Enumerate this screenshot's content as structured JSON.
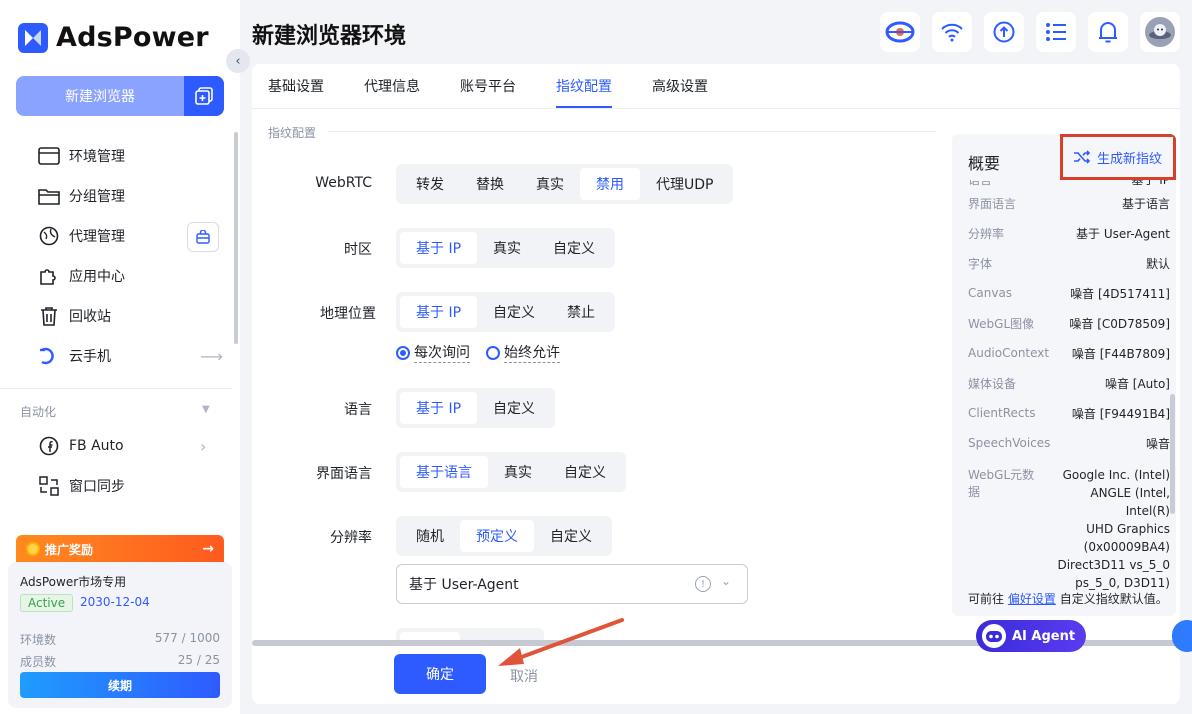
{
  "app": {
    "brand": "AdsPower",
    "page_title": "新建浏览器环境"
  },
  "sidebar": {
    "new_browser_label": "新建浏览器",
    "nav": [
      {
        "label": "环境管理",
        "icon": "browser-window-icon"
      },
      {
        "label": "分组管理",
        "icon": "folder-icon"
      },
      {
        "label": "代理管理",
        "icon": "globe-pin-icon"
      },
      {
        "label": "应用中心",
        "icon": "puzzle-icon"
      },
      {
        "label": "回收站",
        "icon": "trash-icon"
      },
      {
        "label": "云手机",
        "icon": "cloud-phone-icon"
      }
    ],
    "section_automation": "自动化",
    "nav2": [
      {
        "label": "FB Auto",
        "icon": "facebook-icon"
      },
      {
        "label": "窗口同步",
        "icon": "window-sync-icon"
      }
    ],
    "promo_label": "推广奖励",
    "plan": {
      "name": "AdsPower市场专用",
      "status": "Active",
      "expiry": "2030-12-04",
      "env_label": "环境数",
      "env_value": "577 / 1000",
      "member_label": "成员数",
      "member_value": "25 / 25",
      "renew_label": "续期"
    }
  },
  "tabs": [
    "基础设置",
    "代理信息",
    "账号平台",
    "指纹配置",
    "高级设置"
  ],
  "active_tab": "指纹配置",
  "form": {
    "section_title": "指纹配置",
    "webrtc": {
      "label": "WebRTC",
      "options": [
        "转发",
        "替换",
        "真实",
        "禁用",
        "代理UDP"
      ],
      "selected": "禁用"
    },
    "timezone": {
      "label": "时区",
      "options": [
        "基于 IP",
        "真实",
        "自定义"
      ],
      "selected": "基于 IP"
    },
    "geo": {
      "label": "地理位置",
      "options": [
        "基于 IP",
        "自定义",
        "禁止"
      ],
      "selected": "基于 IP",
      "radio_ask": "每次询问",
      "radio_allow": "始终允许",
      "radio_selected": "每次询问"
    },
    "language": {
      "label": "语言",
      "options": [
        "基于 IP",
        "自定义"
      ],
      "selected": "基于 IP"
    },
    "ui_language": {
      "label": "界面语言",
      "options": [
        "基于语言",
        "真实",
        "自定义"
      ],
      "selected": "基于语言"
    },
    "resolution": {
      "label": "分辨率",
      "options": [
        "随机",
        "预定义",
        "自定义"
      ],
      "selected": "预定义",
      "select_value": "基于 User-Agent"
    },
    "confirm_label": "确定",
    "cancel_label": "取消"
  },
  "overview": {
    "title": "概要",
    "generate_label": "生成新指纹",
    "cut_row_left": "语言",
    "cut_row_right": "基于 IP",
    "rows": [
      {
        "k": "界面语言",
        "v": "基于语言"
      },
      {
        "k": "分辨率",
        "v": "基于 User-Agent"
      },
      {
        "k": "字体",
        "v": "默认"
      },
      {
        "k": "Canvas",
        "v": "噪音 [4D517411]"
      },
      {
        "k": "WebGL图像",
        "v": "噪音 [C0D78509]"
      },
      {
        "k": "AudioContext",
        "v": "噪音 [F44B7809]"
      },
      {
        "k": "媒体设备",
        "v": "噪音 [Auto]"
      },
      {
        "k": "ClientRects",
        "v": "噪音 [F94491B4]"
      },
      {
        "k": "SpeechVoices",
        "v": "噪音"
      }
    ],
    "webgl_meta_label": "WebGL元数据",
    "webgl_meta_lines": [
      "Google Inc. (Intel)",
      "ANGLE (Intel, Intel(R)",
      "UHD Graphics",
      "(0x00009BA4)",
      "Direct3D11 vs_5_0",
      "ps_5_0, D3D11)"
    ],
    "footer_prefix": "可前往",
    "footer_link": "偏好设置",
    "footer_suffix": "自定义指纹默认值。"
  },
  "ai_agent_label": "AI Agent",
  "colors": {
    "accent": "#2e5bff",
    "highlight_box": "#d6412b",
    "arrow": "#e0553a"
  }
}
